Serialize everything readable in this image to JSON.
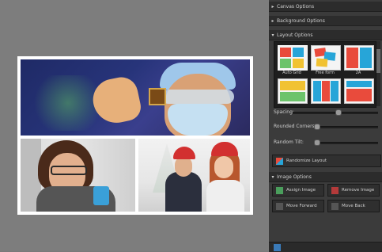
{
  "panel": {
    "sections": {
      "canvas_options": "Canvas Options",
      "background_options": "Background Options",
      "layout_options": "Layout Options",
      "image_options": "Image Options"
    },
    "layout_thumbs": [
      {
        "label": "Auto Grid"
      },
      {
        "label": "Free form"
      },
      {
        "label": "2A"
      },
      {
        "label": ""
      },
      {
        "label": ""
      },
      {
        "label": ""
      }
    ],
    "controls": {
      "spacing": "Spacing:",
      "rounded_corners": "Rounded Corners:",
      "random_tilt": "Random Tilt:"
    },
    "buttons": {
      "randomize": "Randomize Layout",
      "assign_image": "Assign Image",
      "remove_image": "Remove Image",
      "move_forward": "Move Forward",
      "move_back": "Move Back"
    },
    "colors": {
      "panel_bg": "#3b3b3b",
      "section_bg": "#2c2c2c",
      "canvas_bg": "#7d7d7d"
    }
  }
}
